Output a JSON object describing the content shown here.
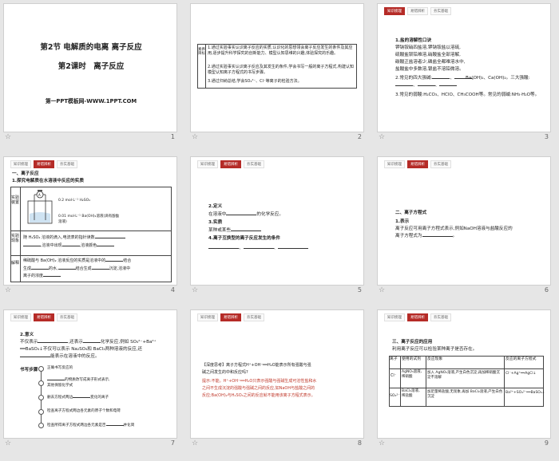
{
  "tabs": [
    "知识梳理",
    "易错辨析",
    "夯实基础"
  ],
  "slides": [
    {
      "num": "1",
      "title": "第2节 电解质的电离 离子反应",
      "subtitle": "第2课时　离子反应",
      "footer": "第一PPT模板网-WWW.1PPT.COM"
    },
    {
      "num": "2",
      "side_label": "素养目标",
      "items": [
        "1.通过实验事实认识离子反应的实质,认识化的思想领会离子反应发生的条件及其应用,逐步提升科学探究的创新能力、模型认知思维的兴趣,体验探究的乐趣。",
        "2.通过实验事实认识离子反应及其发生的条件,学会书写一般的离子方程式,构建认知模型认知离子方程式的书写步骤。",
        "3.通过归纳总结,学会SO₄²⁻、Cl⁻等离子的检验方法。"
      ]
    },
    {
      "num": "3",
      "lines": [
        "1.盐的溶解性口诀",
        "钾钠铵硝四盐溶,钾钠铵盐以溶硫,",
        "硫酸盐钡铅难溶,硝酸盐全部溶解,",
        "碳酸正盐溶者少,磷盐全都难溶水中,",
        "盐酸盐中多数溶,银盐不溶铅微溶。",
        "2.常见的四大强碱:",
        "Ba(OH)₂、Ca(OH)₂。三大强酸:",
        "3.常见的弱酸:H₂CO₃、HClO、CH₃COOH等。常见的弱碱:NH₃·H₂O等。"
      ]
    },
    {
      "num": "4",
      "heading": "一、离子反应",
      "sub": "1.探究电解质在水溶液中反应的实质",
      "row_labels": [
        "实验装置",
        "实验现象",
        "解释"
      ],
      "beaker_label1": "0.2 mol·L⁻¹ H₂SO₄",
      "beaker_label2": "0.01 mol·L⁻¹ Ba(OH)₂溶液(滴有酚酞溶液)",
      "phen_note": "(滴有酚酞溶液)",
      "observation1": "随 H₂SO₄ 溶液的滴入,电流表的指针读数",
      "observation2": "溶液中出现",
      "observation3": "溶液颜色",
      "explain1": "稀硫酸与 Ba(OH)₂ 溶液反应的实质是溶液中的",
      "explain2": "生成",
      "explain3": "的水,",
      "explain4": "结合生成",
      "explain5": "沉淀,溶液中",
      "explain6": "离子的浓度"
    },
    {
      "num": "5",
      "lines": [
        "2.定义",
        "在溶液中",
        "的化学反应。",
        "3.实质",
        "某种或某些",
        "4.离子互换型的离子反应发生的条件"
      ]
    },
    {
      "num": "6",
      "heading": "二、离子方程式",
      "lines": [
        "1.表示",
        "离子反应可用离子方程式表示,例如NaOH溶液与盐酸反应的",
        "离子方程式为"
      ]
    },
    {
      "num": "7",
      "heading": "2.意义",
      "lines": [
        "不仅表示",
        "还表示",
        "化学反应,例如 SO₄²⁻+Ba²⁺",
        "══BaSO₄↓不仅可以表示 Na₂SO₄和 BaCl₂两种溶液的反应,还",
        "能表示在溶液中的反应。"
      ],
      "steps_label": "书写步骤",
      "steps": [
        "正确书写反应的",
        "的物质改写成离子形式表示,",
        "其他保留化学式",
        "删去方程式两边",
        "变化的离子",
        "检查离子方程式两边各元素的原子个数和电荷",
        "检查所得离子方程式两边各元素是否",
        "并化简"
      ]
    },
    {
      "num": "8",
      "lines": [
        "【深度思考】离子方程式H⁺+OH⁻══H₂O能表示所有强酸与强",
        "碱之间发生的中和反应吗?",
        "提示:不能。H⁺+OH⁻══H₂O只表示强酸与强碱生成可溶性盐和水",
        "之间不生成沉淀的强酸与强碱之间的反应,如NaOH与盐酸之间的",
        "反应;Ba(OH)₂与H₂SO₄之间的反应就不能用该离子方程式表示。"
      ]
    },
    {
      "num": "9",
      "heading": "三、离子反应的应用",
      "intro": "利用离子反应可以检验某种离子是否存在。",
      "table_headers": [
        "离子",
        "使用的试剂",
        "反应现象",
        "反应的离子方程式"
      ],
      "table_rows": [
        [
          "Cl⁻",
          "AgNO₃溶液、稀硝酸",
          "加入 AgNO₃溶液,产生白色沉淀,再加稀硝酸沉淀不溶解",
          "Cl⁻+Ag⁺══AgCl↓"
        ],
        [
          "SO₄²⁻",
          "BaCl₂溶液、稀盐酸",
          "加足量稀盐酸,无现象,再加 BaCl₂溶液,产生白色沉淀",
          "Ba²⁺+SO₄²⁻══BaSO₄↓"
        ]
      ]
    }
  ]
}
